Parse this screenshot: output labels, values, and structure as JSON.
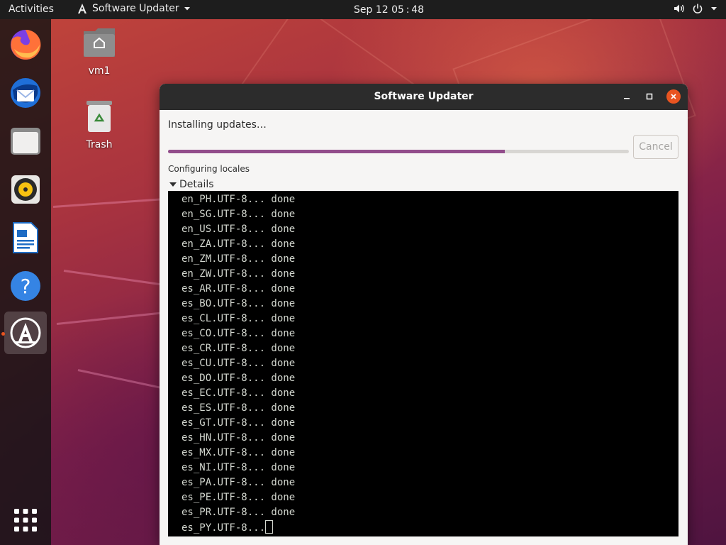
{
  "topbar": {
    "activities": "Activities",
    "app_name": "Software Updater",
    "clock": "Sep 12  05 : 48"
  },
  "desktop": {
    "icons": [
      {
        "label": "vm1",
        "icon": "home-folder-icon"
      },
      {
        "label": "Trash",
        "icon": "trash-icon"
      }
    ]
  },
  "dock": {
    "items": [
      {
        "name": "firefox-icon"
      },
      {
        "name": "thunderbird-icon"
      },
      {
        "name": "files-icon"
      },
      {
        "name": "rhythmbox-icon"
      },
      {
        "name": "libreoffice-writer-icon"
      },
      {
        "name": "help-icon"
      },
      {
        "name": "software-updater-icon",
        "active": true
      },
      {
        "name": "show-applications-icon"
      }
    ]
  },
  "window": {
    "title": "Software Updater",
    "status": "Installing updates…",
    "progress_percent": 73,
    "cancel_label": "Cancel",
    "substatus": "Configuring locales",
    "details_label": "Details",
    "terminal_lines": [
      "en_PH.UTF-8... done",
      "en_SG.UTF-8... done",
      "en_US.UTF-8... done",
      "en_ZA.UTF-8... done",
      "en_ZM.UTF-8... done",
      "en_ZW.UTF-8... done",
      "es_AR.UTF-8... done",
      "es_BO.UTF-8... done",
      "es_CL.UTF-8... done",
      "es_CO.UTF-8... done",
      "es_CR.UTF-8... done",
      "es_CU.UTF-8... done",
      "es_DO.UTF-8... done",
      "es_EC.UTF-8... done",
      "es_ES.UTF-8... done",
      "es_GT.UTF-8... done",
      "es_HN.UTF-8... done",
      "es_MX.UTF-8... done",
      "es_NI.UTF-8... done",
      "es_PA.UTF-8... done",
      "es_PE.UTF-8... done",
      "es_PR.UTF-8... done"
    ],
    "terminal_current": "es_PY.UTF-8..."
  },
  "colors": {
    "accent": "#e95420",
    "progress": "#924d8b",
    "titlebar": "#2c2c2c"
  }
}
